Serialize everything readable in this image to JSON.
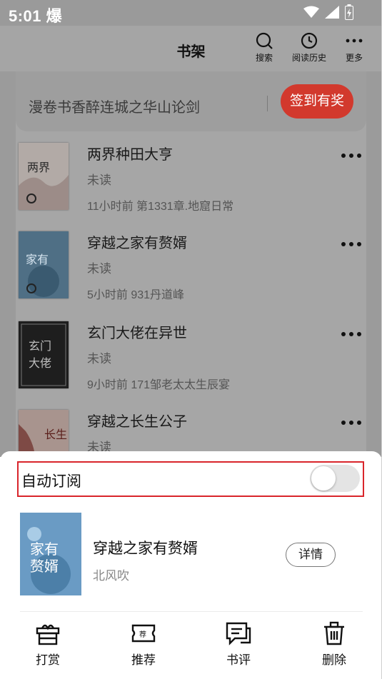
{
  "status_bar": {
    "time": "5:01",
    "weather": "爆"
  },
  "header": {
    "title": "书架",
    "actions": [
      {
        "label": "搜索",
        "icon": "search-icon"
      },
      {
        "label": "阅读历史",
        "icon": "history-icon"
      },
      {
        "label": "更多",
        "icon": "more-icon"
      }
    ]
  },
  "notice": {
    "text": "漫卷书香醉连城之华山论剑",
    "checkin_label": "签到有奖"
  },
  "books": [
    {
      "title": "两界种田大亨",
      "status": "未读",
      "update": "11小时前 第1331章.地窟日常"
    },
    {
      "title": "穿越之家有赘婿",
      "status": "未读",
      "update": "5小时前 931丹道峰"
    },
    {
      "title": "玄门大佬在异世",
      "status": "未读",
      "update": "9小时前 171邹老太太生辰宴"
    },
    {
      "title": "穿越之长生公子",
      "status": "未读",
      "update": ""
    }
  ],
  "sheet": {
    "auto_subscribe_label": "自动订阅",
    "auto_subscribe_on": false,
    "book_title": "穿越之家有赘婿",
    "book_author": "北风吹",
    "detail_label": "详情",
    "actions": [
      {
        "label": "打赏",
        "icon": "gift-icon"
      },
      {
        "label": "推荐",
        "icon": "ticket-icon"
      },
      {
        "label": "书评",
        "icon": "comment-icon"
      },
      {
        "label": "删除",
        "icon": "trash-icon"
      }
    ]
  },
  "colors": {
    "accent": "#d2392d",
    "highlight_border": "#d9252b",
    "overlay": "#a6a6a6"
  }
}
